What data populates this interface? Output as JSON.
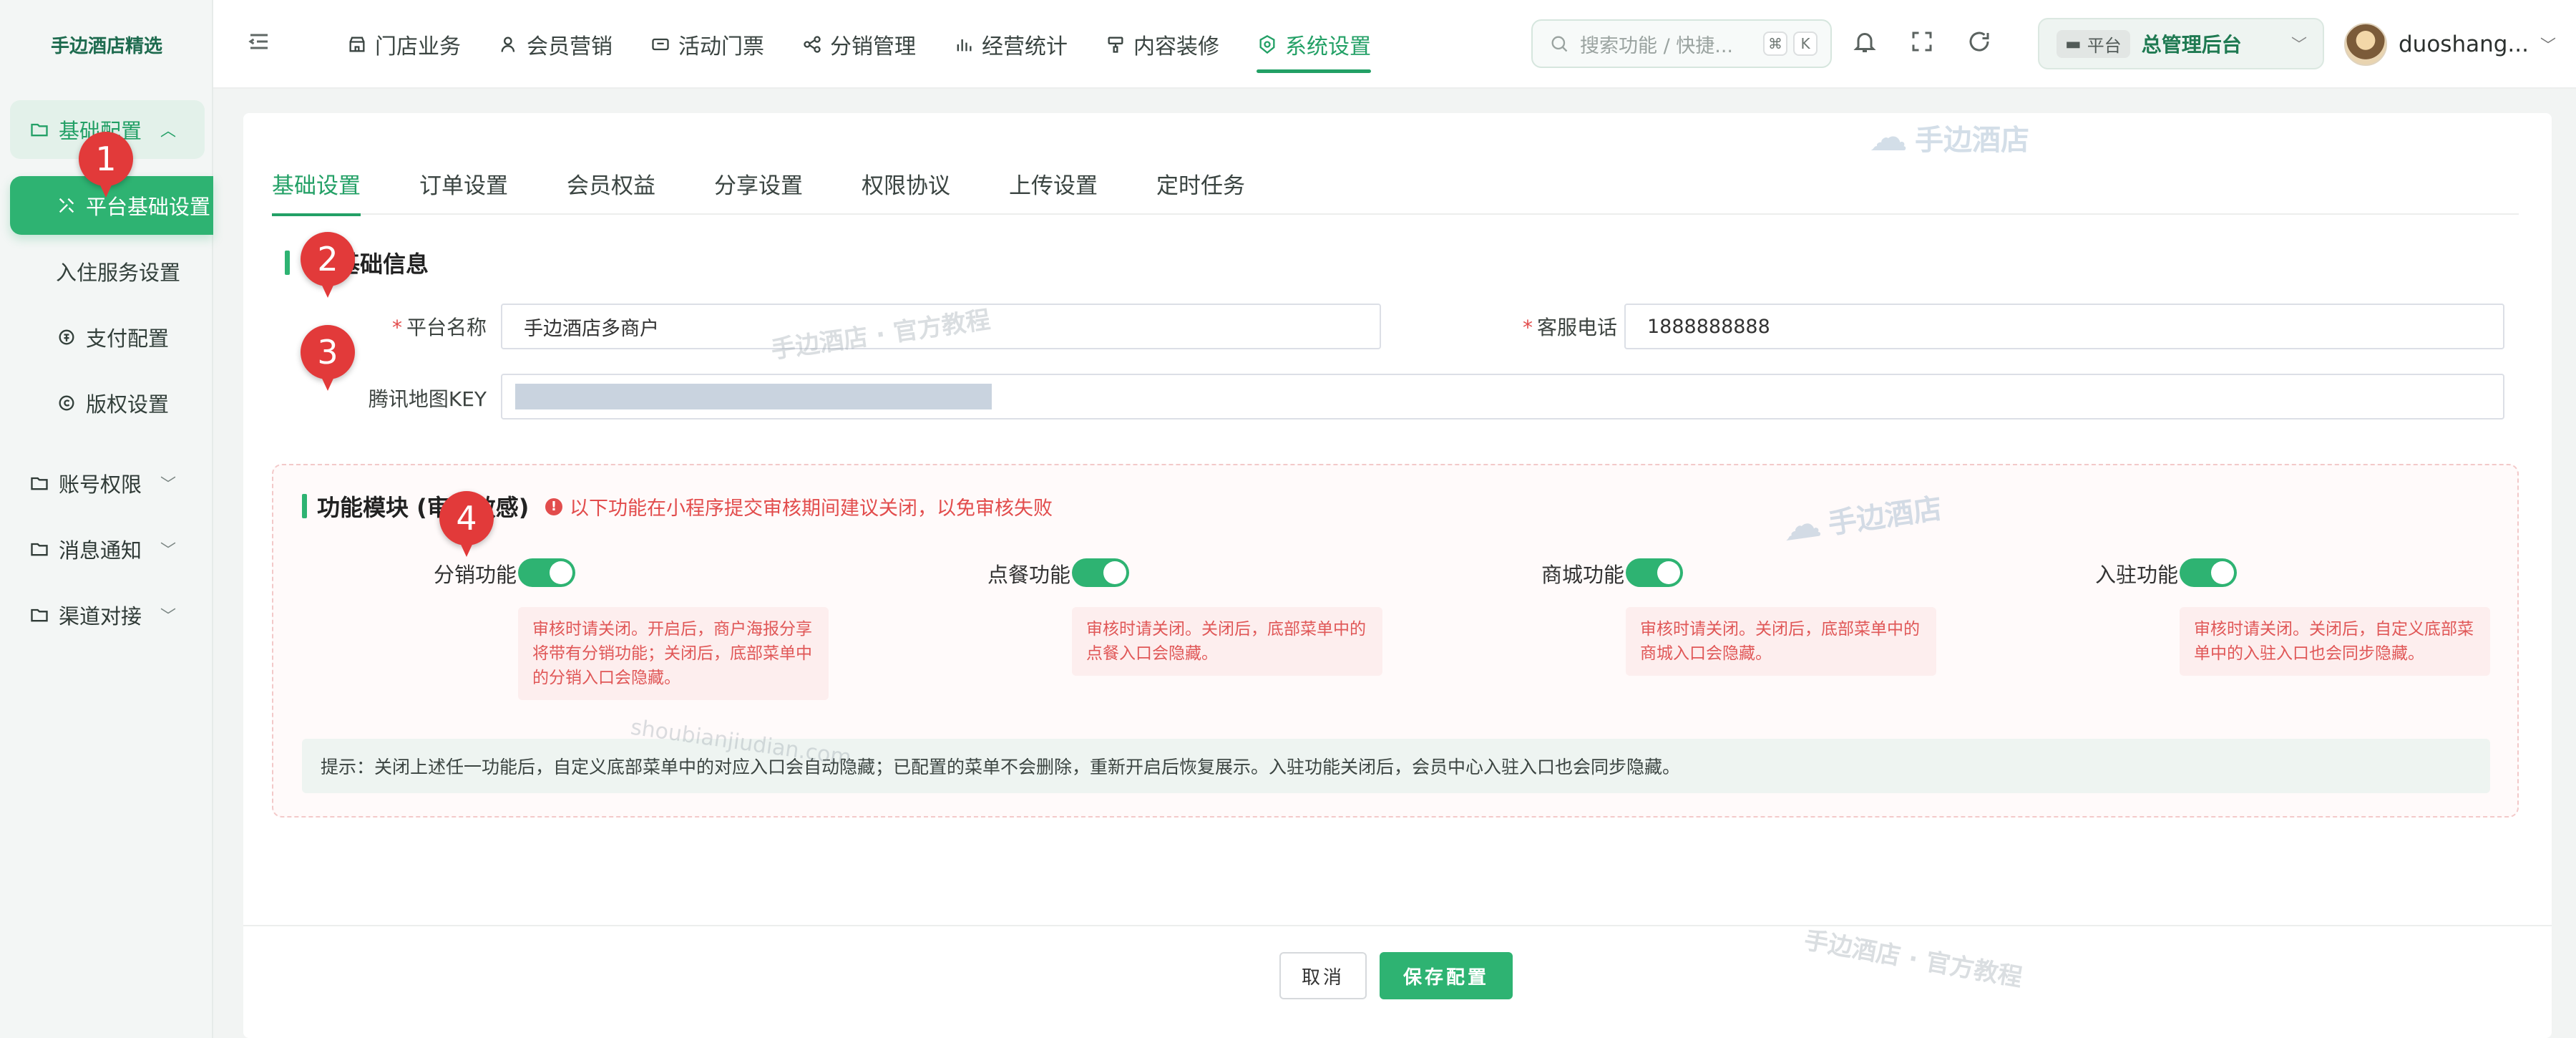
{
  "brand": "手边酒店精选",
  "sidebar": {
    "groups": [
      {
        "label": "基础配置",
        "icon": "folder-icon",
        "open": true
      },
      {
        "label": "账号权限",
        "icon": "folder-icon"
      },
      {
        "label": "消息通知",
        "icon": "folder-icon"
      },
      {
        "label": "渠道对接",
        "icon": "folder-icon"
      }
    ],
    "items": [
      {
        "label": "平台基础设置",
        "icon": "tools-icon",
        "active": true
      },
      {
        "label": "入住服务设置"
      },
      {
        "label": "支付配置",
        "icon": "payment-icon"
      },
      {
        "label": "版权设置",
        "icon": "copyright-icon"
      }
    ]
  },
  "topnav": {
    "items": [
      {
        "label": "门店业务",
        "icon": "store-icon"
      },
      {
        "label": "会员营销",
        "icon": "user-icon"
      },
      {
        "label": "活动门票",
        "icon": "ticket-icon"
      },
      {
        "label": "分销管理",
        "icon": "share-icon"
      },
      {
        "label": "经营统计",
        "icon": "chart-icon"
      },
      {
        "label": "内容装修",
        "icon": "brush-icon"
      },
      {
        "label": "系统设置",
        "icon": "gear-icon",
        "active": true
      }
    ]
  },
  "search": {
    "placeholder": "搜索功能 / 快捷...",
    "key1": "⌘",
    "key2": "K"
  },
  "platform": {
    "tag": "平台",
    "name": "总管理后台"
  },
  "user": {
    "name": "duoshang..."
  },
  "tabs": [
    "基础设置",
    "订单设置",
    "会员权益",
    "分享设置",
    "权限协议",
    "上传设置",
    "定时任务"
  ],
  "basic": {
    "title": "基础信息",
    "platform_name_label": "平台名称",
    "platform_name_value": "手边酒店多商户",
    "phone_label": "客服电话",
    "phone_value": "1888888888",
    "map_key_label": "腾讯地图KEY"
  },
  "modules": {
    "title": "功能模块 (审核敏感)",
    "warning": "以下功能在小程序提交审核期间建议关闭，以免审核失败",
    "features": [
      {
        "label": "分销功能",
        "enabled": true,
        "note": "审核时请关闭。开启后，商户海报分享将带有分销功能；关闭后，底部菜单中的分销入口会隐藏。"
      },
      {
        "label": "点餐功能",
        "enabled": true,
        "note": "审核时请关闭。关闭后，底部菜单中的点餐入口会隐藏。"
      },
      {
        "label": "商城功能",
        "enabled": true,
        "note": "审核时请关闭。关闭后，底部菜单中的商城入口会隐藏。"
      },
      {
        "label": "入驻功能",
        "enabled": true,
        "note": "审核时请关闭。关闭后，自定义底部菜单中的入驻入口也会同步隐藏。"
      }
    ],
    "tip": "提示：关闭上述任一功能后，自定义底部菜单中的对应入口会自动隐藏；已配置的菜单不会删除，重新开启后恢复展示。入驻功能关闭后，会员中心入驻入口也会同步隐藏。"
  },
  "buttons": {
    "cancel": "取消",
    "save": "保存配置"
  },
  "watermarks": {
    "logo_text": "手边酒店",
    "tutorial": "手边酒店 · 官方教程",
    "domain": "shoubianjiudian.com"
  },
  "markers": [
    "1",
    "2",
    "3",
    "4"
  ],
  "colors": {
    "accent": "#2eb372",
    "danger": "#e24c4c",
    "marker": "#e23a3a"
  }
}
